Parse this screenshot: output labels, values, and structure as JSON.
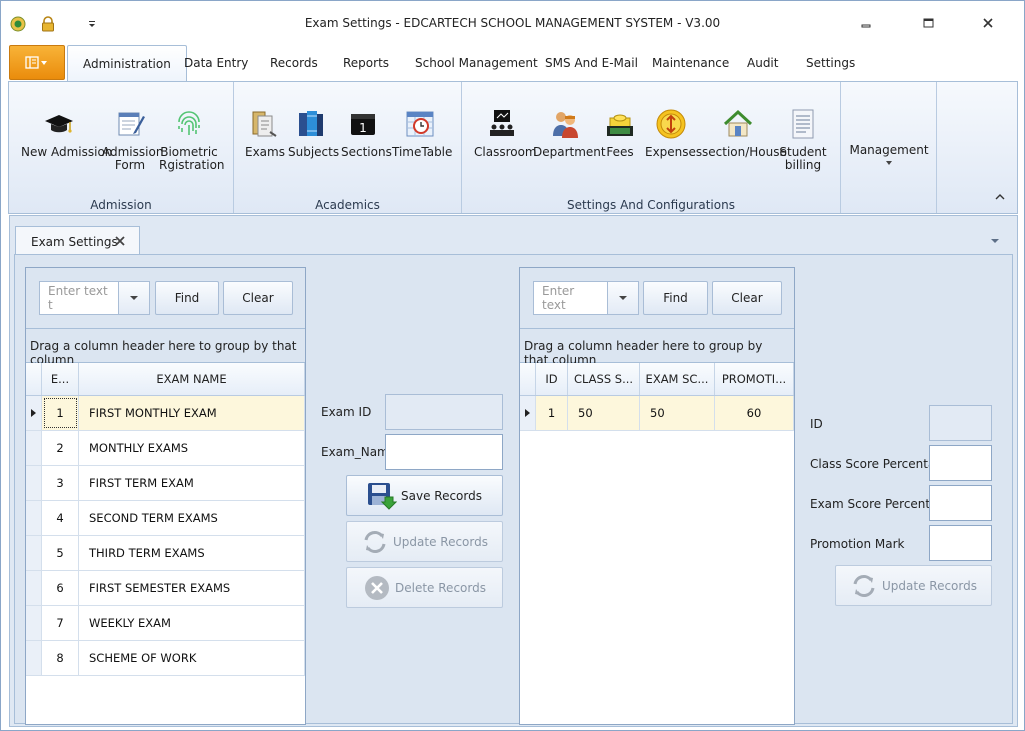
{
  "window": {
    "title": "Exam Settings - EDCARTECH SCHOOL MANAGEMENT SYSTEM  -  V3.00"
  },
  "tabs": [
    "Administration",
    "Data Entry",
    "Records",
    "Reports",
    "School Management",
    "SMS And E-Mail",
    "Maintenance",
    "Audit",
    "Settings"
  ],
  "ribbon": {
    "admission": {
      "label": "Admission",
      "buttons": [
        {
          "line1": "New Admission",
          "line2": "",
          "icon": "graduation-cap-icon"
        },
        {
          "line1": "Admission",
          "line2": "Form",
          "icon": "form-pencil-icon"
        },
        {
          "line1": "Biometric",
          "line2": "Rgistration",
          "icon": "fingerprint-icon"
        }
      ]
    },
    "academics": {
      "label": "Academics",
      "buttons": [
        {
          "line1": "Exams",
          "icon": "exams-icon"
        },
        {
          "line1": "Subjects",
          "icon": "books-icon"
        },
        {
          "line1": "Sections",
          "icon": "calendar-icon",
          "glyph": "1"
        },
        {
          "line1": "TimeTable",
          "icon": "clock-calendar-icon"
        }
      ]
    },
    "settings": {
      "label": "Settings And Configurations",
      "buttons": [
        {
          "line1": "Classroom",
          "line2": "",
          "icon": "classroom-icon"
        },
        {
          "line1": "Department",
          "line2": "",
          "icon": "people-icon"
        },
        {
          "line1": "Fees",
          "line2": "",
          "icon": "cash-icon"
        },
        {
          "line1": "Expenses",
          "line2": "",
          "icon": "coin-icon"
        },
        {
          "line1": "section/House",
          "line2": "",
          "icon": "house-icon"
        },
        {
          "line1": "Student",
          "line2": "billing",
          "icon": "document-icon"
        }
      ]
    },
    "management": {
      "label": "Management"
    }
  },
  "doc_tab": {
    "label": "Exam Settings"
  },
  "left_grid": {
    "search_placeholder": "Enter text t",
    "find": "Find",
    "clear": "Clear",
    "group_hint": "Drag a column header here to group by that column",
    "columns": [
      "E...",
      "EXAM NAME"
    ],
    "rows": [
      {
        "id": "1",
        "name": "FIRST MONTHLY EXAM"
      },
      {
        "id": "2",
        "name": "MONTHLY EXAMS"
      },
      {
        "id": "3",
        "name": "FIRST TERM EXAM"
      },
      {
        "id": "4",
        "name": "SECOND TERM EXAMS"
      },
      {
        "id": "5",
        "name": "THIRD TERM EXAMS"
      },
      {
        "id": "6",
        "name": "FIRST SEMESTER EXAMS"
      },
      {
        "id": "7",
        "name": "WEEKLY EXAM"
      },
      {
        "id": "8",
        "name": "SCHEME OF WORK"
      }
    ]
  },
  "exam_form": {
    "exam_id_label": "Exam ID",
    "exam_name_label": "Exam_Name",
    "save": "Save Records",
    "update": "Update Records",
    "delete": "Delete Records"
  },
  "right_grid": {
    "search_placeholder": "Enter text",
    "find": "Find",
    "clear": "Clear",
    "group_hint": "Drag a column header here to group by that column",
    "columns": [
      "ID",
      "CLASS S...",
      "EXAM SC...",
      "PROMOTI..."
    ],
    "rows": [
      {
        "id": "1",
        "class": "50",
        "exam": "50",
        "promo": "60"
      }
    ]
  },
  "score_form": {
    "id_label": "ID",
    "class_label": "Class Score Percentage",
    "exam_label": "Exam Score Percentage",
    "promo_label": "Promotion Mark",
    "update": "Update Records"
  },
  "colors": {
    "accent_orange": "#f0a01f",
    "selected_row": "#fdf7dc",
    "panel_bg": "#dbe5f1"
  }
}
